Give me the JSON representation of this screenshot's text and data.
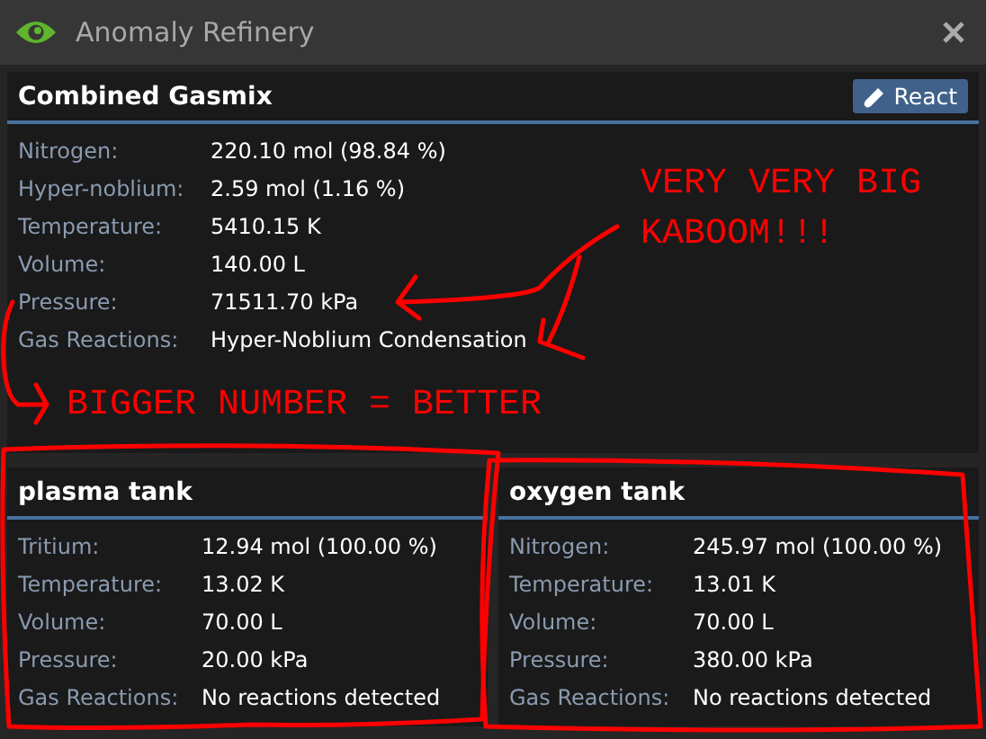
{
  "window": {
    "title": "Anomaly Refinery"
  },
  "combined": {
    "title": "Combined Gasmix",
    "button": "React",
    "rows": [
      {
        "label": "Nitrogen:",
        "value": "220.10 mol (98.84 %)"
      },
      {
        "label": "Hyper-noblium:",
        "value": "2.59 mol (1.16 %)"
      },
      {
        "label": "Temperature:",
        "value": "5410.15 K"
      },
      {
        "label": "Volume:",
        "value": "140.00 L"
      },
      {
        "label": "Pressure:",
        "value": "71511.70 kPa"
      },
      {
        "label": "Gas Reactions:",
        "value": "Hyper-Noblium Condensation"
      }
    ]
  },
  "tanks": [
    {
      "title": "plasma tank",
      "rows": [
        {
          "label": "Tritium:",
          "value": "12.94 mol (100.00 %)"
        },
        {
          "label": "Temperature:",
          "value": "13.02 K"
        },
        {
          "label": "Volume:",
          "value": "70.00 L"
        },
        {
          "label": "Pressure:",
          "value": "20.00 kPa"
        },
        {
          "label": "Gas Reactions:",
          "value": "No reactions detected"
        }
      ]
    },
    {
      "title": "oxygen tank",
      "rows": [
        {
          "label": "Nitrogen:",
          "value": "245.97 mol (100.00 %)"
        },
        {
          "label": "Temperature:",
          "value": "13.01 K"
        },
        {
          "label": "Volume:",
          "value": "70.00 L"
        },
        {
          "label": "Pressure:",
          "value": "380.00 kPa"
        },
        {
          "label": "Gas Reactions:",
          "value": "No reactions detected"
        }
      ]
    }
  ],
  "annotations": [
    {
      "text": "VERY VERY BIG"
    },
    {
      "text": "KABOOM!!!"
    },
    {
      "text": "BIGGER NUMBER = BETTER"
    }
  ]
}
